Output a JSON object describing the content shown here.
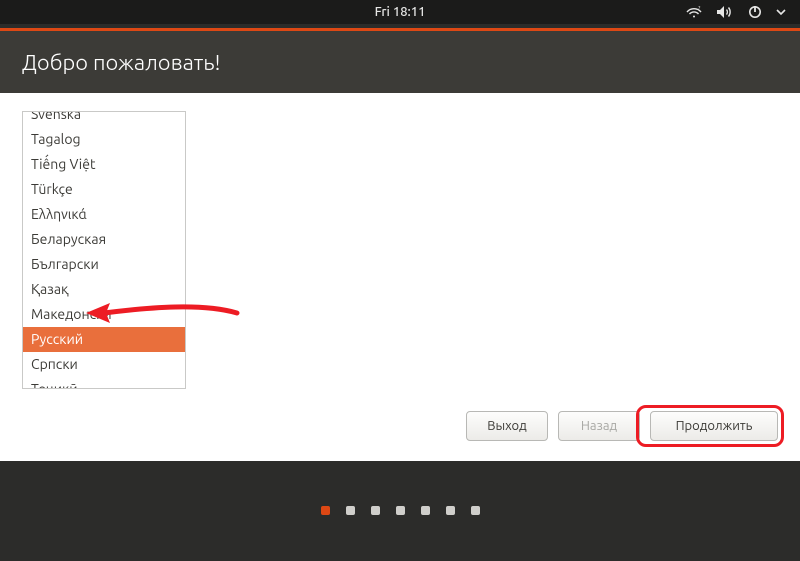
{
  "panel": {
    "clock": "Fri 18:11",
    "icons": [
      "network-icon",
      "volume-icon",
      "power-icon",
      "chevron-down-icon"
    ]
  },
  "installer": {
    "title": "Добро пожаловать!",
    "languages": {
      "items": [
        "Svenska",
        "Tagalog",
        "Tiếng Việt",
        "Türkçe",
        "Ελληνικά",
        "Беларуская",
        "Български",
        "Қазақ",
        "Македонски",
        "Русский",
        "Српски",
        "Тоҷикӣ"
      ],
      "selected_index": 9
    },
    "buttons": {
      "quit": "Выход",
      "back": "Назад",
      "continue": "Продолжить"
    }
  },
  "pager": {
    "count": 7,
    "active_index": 0
  },
  "colors": {
    "accent": "#dd4814",
    "annotation": "#ed1c24"
  }
}
